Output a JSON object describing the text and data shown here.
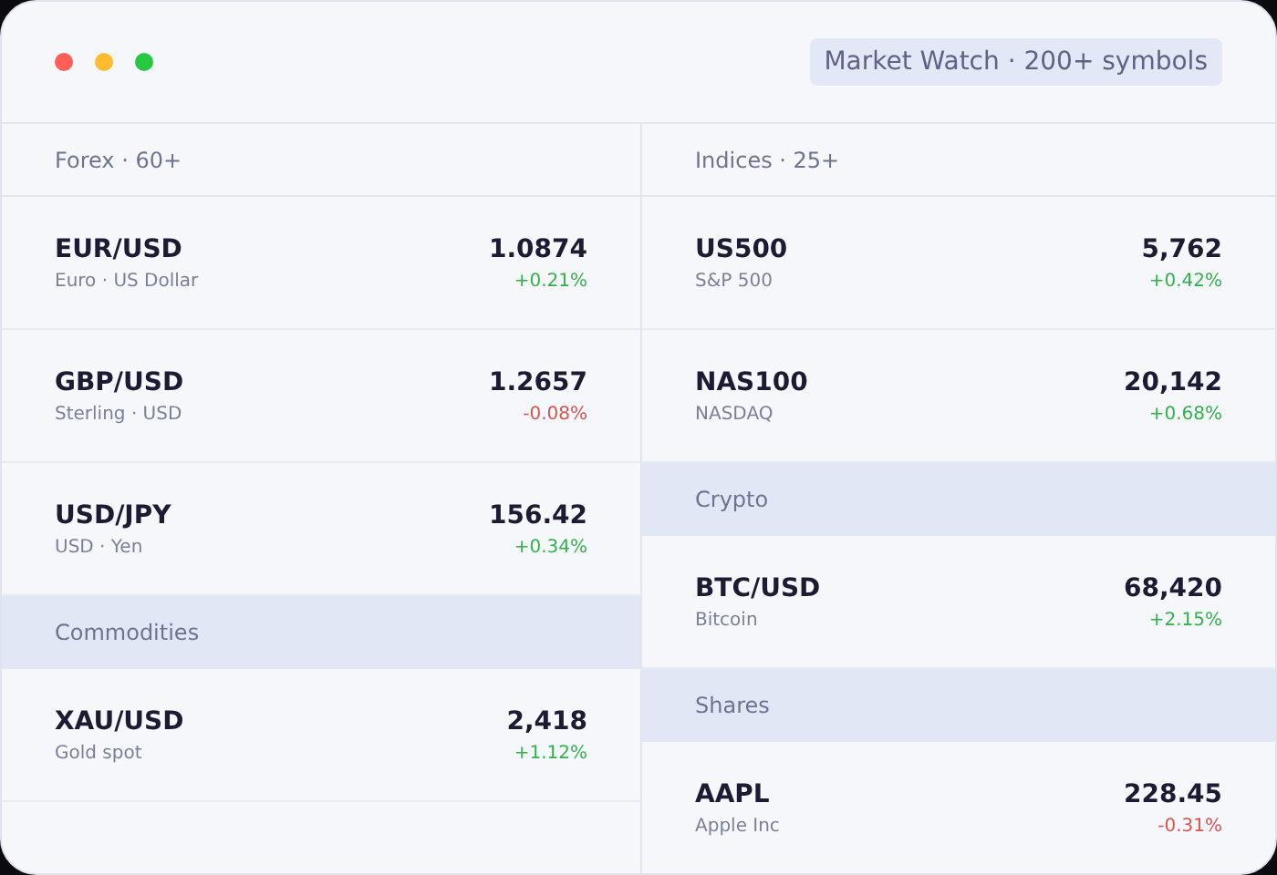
{
  "window": {
    "controls": [
      {
        "color": "#ff5f57"
      },
      {
        "color": "#febc2e"
      },
      {
        "color": "#28c840"
      }
    ],
    "title": "Market Watch · 200+ symbols"
  },
  "columns": [
    {
      "sections": [
        {
          "title": "Forex · 60+",
          "shaded": false,
          "rows": [
            {
              "symbol": "EUR/USD",
              "name": "Euro · US Dollar",
              "price": "1.0874",
              "change": "+0.21%",
              "negative": false
            },
            {
              "symbol": "GBP/USD",
              "name": "Sterling · USD",
              "price": "1.2657",
              "change": "-0.08%",
              "negative": true
            },
            {
              "symbol": "USD/JPY",
              "name": "USD · Yen",
              "price": "156.42",
              "change": "+0.34%",
              "negative": false
            }
          ]
        },
        {
          "title": "Commodities",
          "shaded": true,
          "rows": [
            {
              "symbol": "XAU/USD",
              "name": "Gold spot",
              "price": "2,418",
              "change": "+1.12%",
              "negative": false
            }
          ]
        }
      ]
    },
    {
      "sections": [
        {
          "title": "Indices · 25+",
          "shaded": false,
          "rows": [
            {
              "symbol": "US500",
              "name": "S&P 500",
              "price": "5,762",
              "change": "+0.42%",
              "negative": false
            },
            {
              "symbol": "NAS100",
              "name": "NASDAQ",
              "price": "20,142",
              "change": "+0.68%",
              "negative": false
            }
          ]
        },
        {
          "title": "Crypto",
          "shaded": true,
          "rows": [
            {
              "symbol": "BTC/USD",
              "name": "Bitcoin",
              "price": "68,420",
              "change": "+2.15%",
              "negative": false
            }
          ]
        },
        {
          "title": "Shares",
          "shaded": true,
          "rows": [
            {
              "symbol": "AAPL",
              "name": "Apple Inc",
              "price": "228.45",
              "change": "-0.31%",
              "negative": true
            }
          ]
        }
      ]
    }
  ]
}
